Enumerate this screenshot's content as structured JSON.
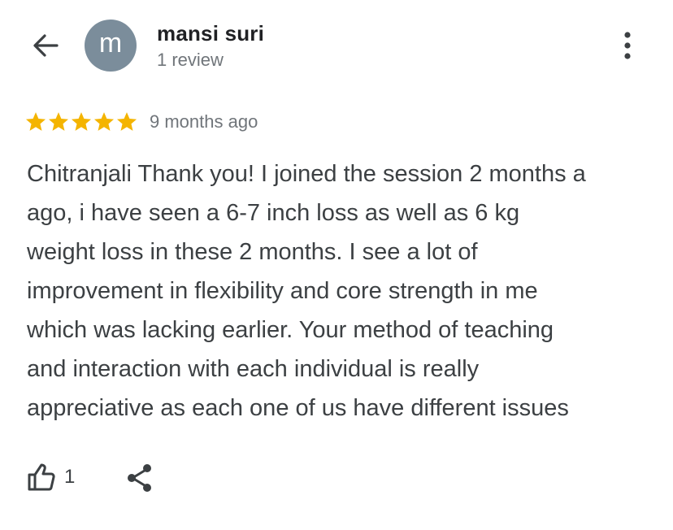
{
  "header": {
    "back_icon": "arrow-back-icon",
    "avatar_letter": "m",
    "avatar_color": "#7b8d9b",
    "reviewer_name": "mansi suri",
    "reviewer_review_count": "1 review",
    "more_icon": "more-vert-icon"
  },
  "review": {
    "rating": 5,
    "rating_max": 5,
    "star_color": "#f4b400",
    "time_ago": "9 months ago",
    "text": "Chitranjali Thank you! I joined the session 2 months a\nago, i have seen a 6-7 inch loss as well as 6 kg\nweight loss in these 2 months. I see a lot of\nimprovement in flexibility and core strength in me\nwhich was lacking earlier. Your method of teaching\nand interaction with each individual is really\nappreciative as each one of us have different issues"
  },
  "actions": {
    "like_icon": "thumb-up-icon",
    "like_count": "1",
    "share_icon": "share-icon"
  }
}
